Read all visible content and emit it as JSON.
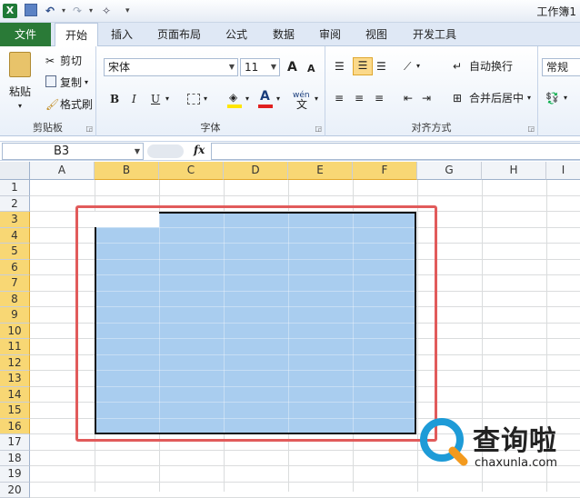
{
  "title_bar": {
    "title": "工作簿1"
  },
  "tabs": {
    "file": "文件",
    "items": [
      "开始",
      "插入",
      "页面布局",
      "公式",
      "数据",
      "审阅",
      "视图",
      "开发工具"
    ]
  },
  "ribbon": {
    "clipboard": {
      "paste": "粘贴",
      "cut": "剪切",
      "copy": "复制",
      "format_painter": "格式刷",
      "label": "剪贴板"
    },
    "font": {
      "name": "宋体",
      "size": "11",
      "bold": "B",
      "italic": "I",
      "underline": "U",
      "grow": "A",
      "shrink": "A",
      "font_color": "A",
      "wen": "wén",
      "label": "字体"
    },
    "alignment": {
      "wrap": "自动换行",
      "merge": "合并后居中",
      "label": "对齐方式"
    },
    "number": {
      "format": "常规"
    }
  },
  "formula_bar": {
    "name_box": "B3",
    "fx": "fx",
    "formula": ""
  },
  "columns": [
    "A",
    "B",
    "C",
    "D",
    "E",
    "F",
    "G",
    "H",
    "I"
  ],
  "rows": [
    "1",
    "2",
    "3",
    "4",
    "5",
    "6",
    "7",
    "8",
    "9",
    "10",
    "11",
    "12",
    "13",
    "14",
    "15",
    "16",
    "17",
    "18",
    "19",
    "20"
  ],
  "watermark": {
    "brand": "查询啦",
    "url": "chaxunla.com"
  },
  "colors": {
    "selection": "#a9cdef",
    "header_selected": "#f8d774",
    "file_tab": "#2a7a37",
    "red_box": "#e15b5b"
  }
}
